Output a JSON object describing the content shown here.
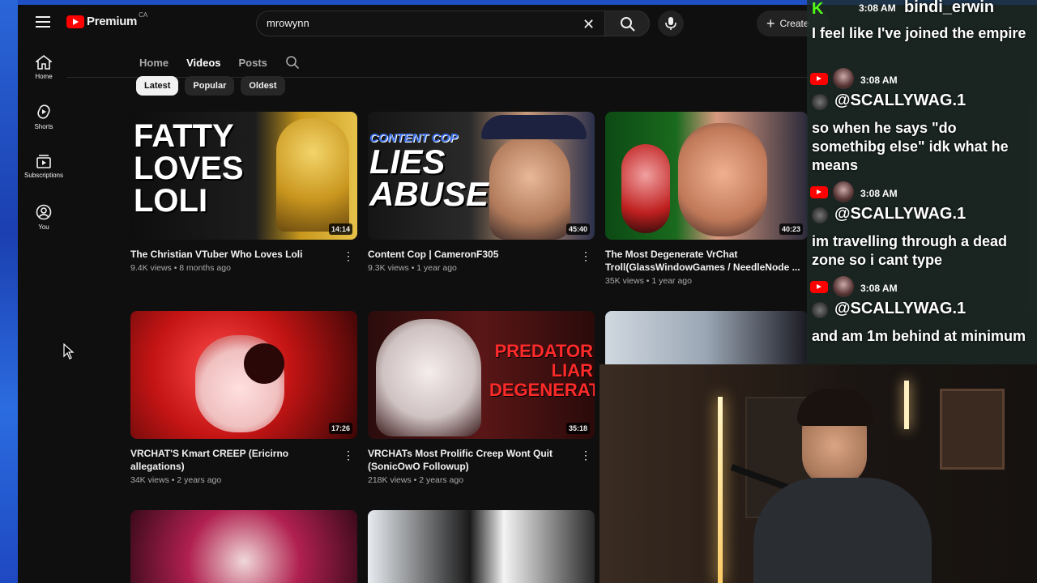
{
  "browser": {
    "app_name": "Premium",
    "region": "CA",
    "search_query": "mrowynn",
    "create_label": "Create"
  },
  "rail": [
    {
      "label": "Home",
      "icon": "home-icon"
    },
    {
      "label": "Shorts",
      "icon": "shorts-icon"
    },
    {
      "label": "Subscriptions",
      "icon": "subscriptions-icon"
    },
    {
      "label": "You",
      "icon": "you-icon"
    }
  ],
  "tabs": [
    "Home",
    "Videos",
    "Posts"
  ],
  "chips": [
    "Latest",
    "Popular",
    "Oldest"
  ],
  "videos": [
    {
      "title": "The Christian VTuber Who Loves Loli",
      "meta": "9.4K views • 8 months ago",
      "duration": "14:14",
      "thumb_text": "FATTY LOVES LOLI",
      "thumb_colors": [
        "#111111",
        "#d4a020"
      ]
    },
    {
      "title": "Content Cop | CameronF305",
      "meta": "9.3K views • 1 year ago",
      "duration": "45:40",
      "thumb_text": "LIES ABUSE",
      "thumb_sub": "CONTENT COP",
      "thumb_colors": [
        "#1a1a1a",
        "#3b3b8a"
      ]
    },
    {
      "title": "The Most Degenerate VrChat Troll(GlassWindowGames / NeedleNode ...",
      "meta": "35K views • 1 year ago",
      "duration": "40:23",
      "thumb_colors": [
        "#0d3a12",
        "#5a2a2a"
      ]
    },
    {
      "title": "VRCHAT'S Kmart CREEP (Ericirno allegations)",
      "meta": "34K views • 2 years ago",
      "duration": "17:26",
      "thumb_colors": [
        "#b01818",
        "#2a0a0a"
      ]
    },
    {
      "title": "VRCHATs Most Prolific Creep Wont Quit (SonicOwO Followup)",
      "meta": "218K views • 2 years ago",
      "duration": "35:18",
      "thumb_text": "PREDATOR LIAR DEGENERATE",
      "thumb_colors": [
        "#3a1010",
        "#8a1c1c"
      ]
    }
  ],
  "chat": {
    "top_time": "3:08 AM",
    "top_user": "bindi_erwin",
    "top_message": "I feel like I've joined the empire",
    "messages": [
      {
        "time": "3:08 AM",
        "user": "@SCALLYWAG.1",
        "text": "so when he says \"do somethibg else\" idk what he means"
      },
      {
        "time": "3:08 AM",
        "user": "@SCALLYWAG.1",
        "text": "im travelling through a dead zone so i cant type"
      },
      {
        "time": "3:08 AM",
        "user": "@SCALLYWAG.1",
        "text": "and am 1m behind at minimum"
      }
    ]
  }
}
